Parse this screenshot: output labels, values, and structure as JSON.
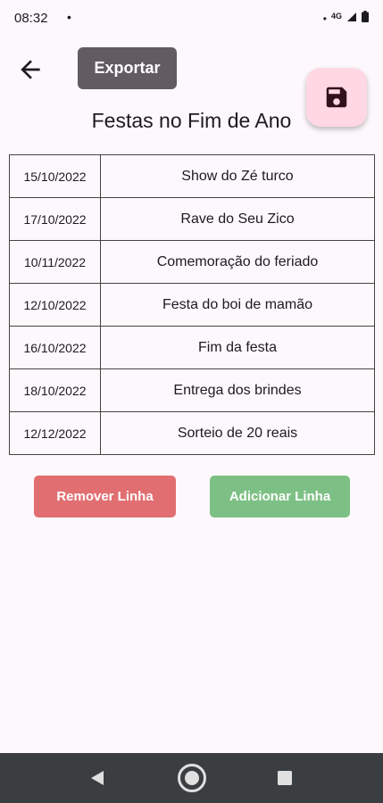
{
  "status_bar": {
    "time": "08:32",
    "notification_dot": "•",
    "right_dot": "•",
    "network_type": "4G"
  },
  "app_bar": {
    "export_label": "Exportar"
  },
  "page": {
    "title": "Festas no Fim de Ano"
  },
  "table": {
    "rows": [
      {
        "date": "15/10/2022",
        "name": "Show do Zé turco"
      },
      {
        "date": "17/10/2022",
        "name": "Rave do Seu Zico"
      },
      {
        "date": "10/11/2022",
        "name": "Comemoração do feriado"
      },
      {
        "date": "12/10/2022",
        "name": "Festa do boi de mamão"
      },
      {
        "date": "16/10/2022",
        "name": "Fim da festa"
      },
      {
        "date": "18/10/2022",
        "name": "Entrega dos brindes"
      },
      {
        "date": "12/12/2022",
        "name": "Sorteio de 20 reais"
      }
    ]
  },
  "actions": {
    "remove_label": "Remover Linha",
    "add_label": "Adicionar Linha"
  },
  "icons": {
    "back": "arrow-back-icon",
    "save": "save-icon",
    "nav_back": "nav-back-icon",
    "nav_home": "nav-home-icon",
    "nav_recents": "nav-recents-icon"
  },
  "colors": {
    "background": "#fdf8fc",
    "export_button": "#625b61",
    "fab_background": "#ffd8e4",
    "fab_icon": "#31111d",
    "remove_button": "#e16f72",
    "add_button": "#7dc085",
    "nav_bar": "#3b3e41"
  }
}
